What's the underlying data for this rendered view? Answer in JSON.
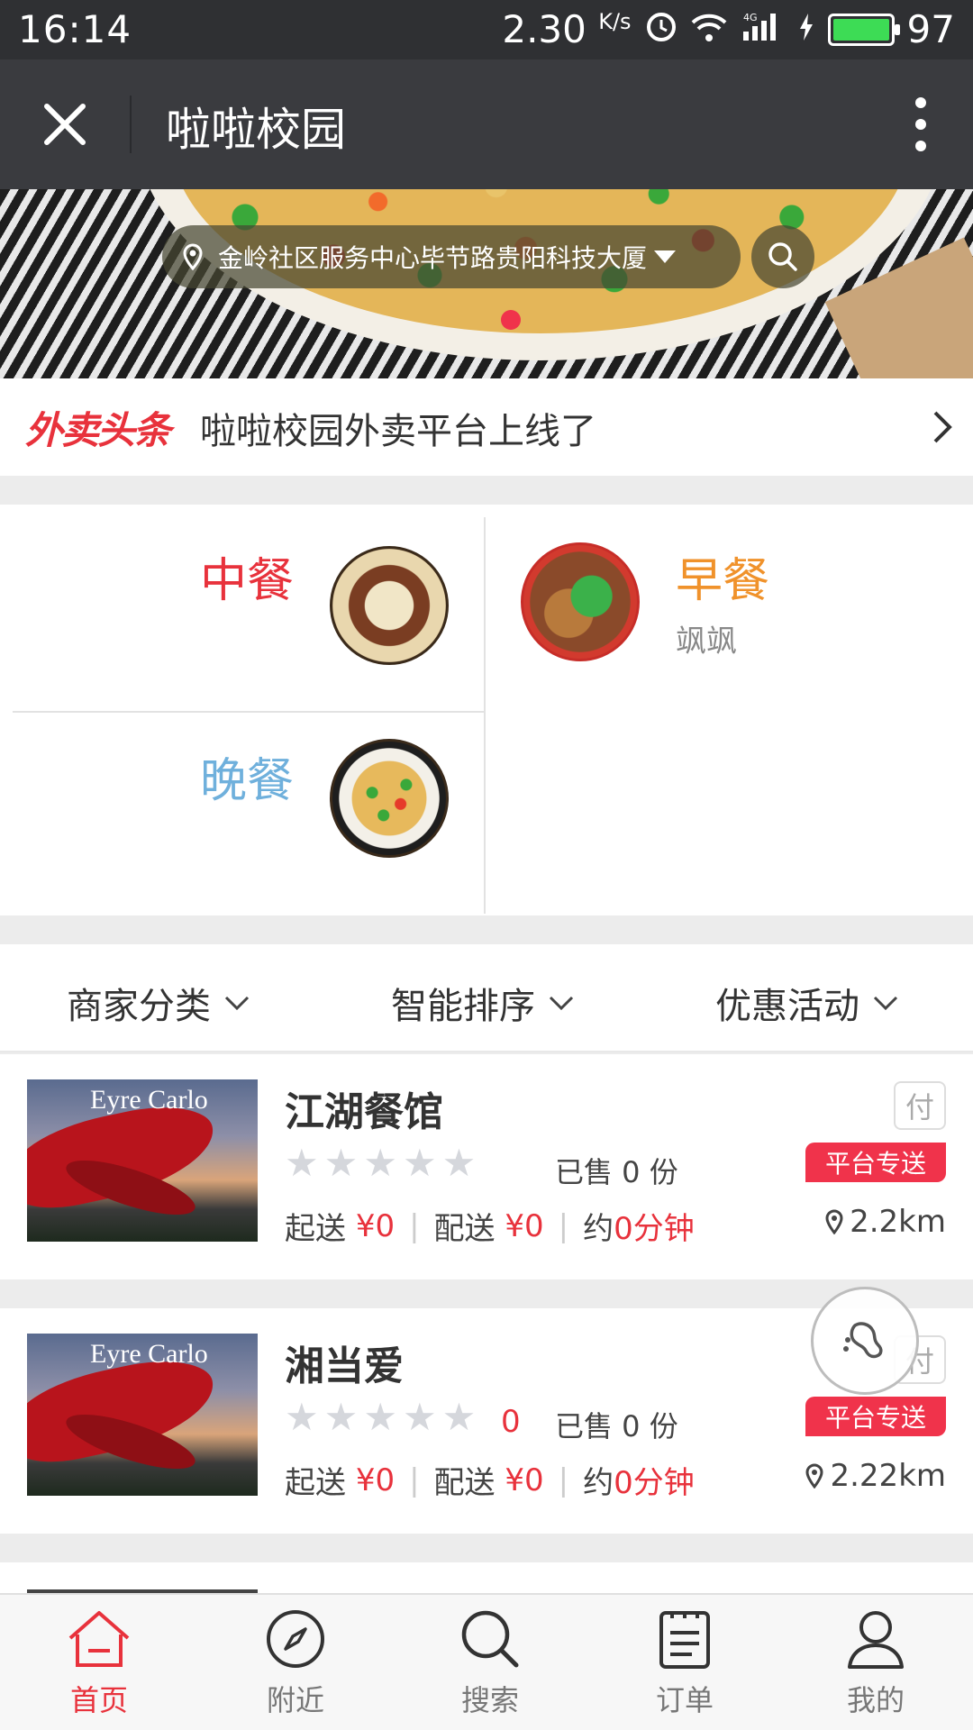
{
  "status_bar": {
    "time": "16:14",
    "speed": "2.30",
    "speed_unit": "K/s",
    "network": "4G",
    "battery": "97"
  },
  "title_bar": {
    "title": "啦啦校园",
    "close_icon": "close-icon",
    "more_icon": "more-vertical-icon"
  },
  "banner": {
    "address": "金岭社区服务中心毕节路贵阳科技大厦",
    "search_icon": "search-icon"
  },
  "headline": {
    "logo": "外卖头条",
    "text": "啦啦校园外卖平台上线了"
  },
  "categories": [
    {
      "title": "中餐",
      "subtitle": "",
      "color": "#e8323c"
    },
    {
      "title": "早餐",
      "subtitle": "飒飒",
      "color": "#f0922b"
    },
    {
      "title": "晚餐",
      "subtitle": "",
      "color": "#6fb0dc"
    }
  ],
  "filters": [
    "商家分类",
    "智能排序",
    "优惠活动"
  ],
  "shops": [
    {
      "name": "江湖餐馆",
      "image_text": "Eyre Carlo",
      "rating": "",
      "sold_label": "已售 0 份",
      "min_order_label": "起送",
      "min_order_value": "¥0",
      "delivery_fee_label": "配送",
      "delivery_fee_value": "¥0",
      "time_prefix": "约",
      "time_value": "0分钟",
      "pay_badge": "付",
      "delivery_badge": "平台专送",
      "distance": "2.2km"
    },
    {
      "name": "湘当爱",
      "image_text": "Eyre Carlo",
      "rating": "0",
      "sold_label": "已售 0 份",
      "min_order_label": "起送",
      "min_order_value": "¥0",
      "delivery_fee_label": "配送",
      "delivery_fee_value": "¥0",
      "time_prefix": "约",
      "time_value": "0分钟",
      "pay_badge": "付",
      "delivery_badge": "平台专送",
      "distance": "2.22km"
    }
  ],
  "bottom_nav": [
    {
      "label": "首页",
      "icon": "home-icon",
      "active": true
    },
    {
      "label": "附近",
      "icon": "compass-icon",
      "active": false
    },
    {
      "label": "搜索",
      "icon": "search-icon",
      "active": false
    },
    {
      "label": "订单",
      "icon": "order-list-icon",
      "active": false
    },
    {
      "label": "我的",
      "icon": "user-icon",
      "active": false
    }
  ],
  "colors": {
    "accent": "#e8323c",
    "statusbar": "#2f3033",
    "titlebar": "#3a3b3f"
  }
}
